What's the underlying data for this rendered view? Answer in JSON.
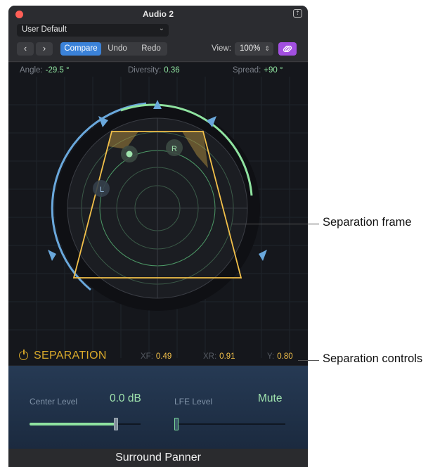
{
  "window": {
    "title": "Audio 2"
  },
  "preset": {
    "value": "User Default"
  },
  "toolbar": {
    "compare": "Compare",
    "undo": "Undo",
    "redo": "Redo",
    "view_label": "View:",
    "view_value": "100%"
  },
  "params": {
    "angle_label": "Angle:",
    "angle_value": "-29.5 °",
    "diversity_label": "Diversity:",
    "diversity_value": "0.36",
    "spread_label": "Spread:",
    "spread_value": "+90 °"
  },
  "panner": {
    "left_label": "L",
    "right_label": "R"
  },
  "separation": {
    "title": "SEPARATION",
    "xf_label": "XF:",
    "xf_value": "0.49",
    "xr_label": "XR:",
    "xr_value": "0.91",
    "y_label": "Y:",
    "y_value": "0.80"
  },
  "levels": {
    "center_label": "Center Level",
    "center_value": "0.0 dB",
    "center_fill": 0.78,
    "lfe_label": "LFE Level",
    "lfe_value": "Mute",
    "lfe_fill": 0.0
  },
  "footer": {
    "title": "Surround Panner"
  },
  "callouts": {
    "frame": "Separation frame",
    "controls": "Separation controls"
  },
  "colors": {
    "accent_blue": "#3b82d8",
    "link_purple": "#a24fe0",
    "separation_gold": "#f2c04a",
    "value_green": "#8fe3a0",
    "speaker_blue": "#6aa8dc"
  }
}
